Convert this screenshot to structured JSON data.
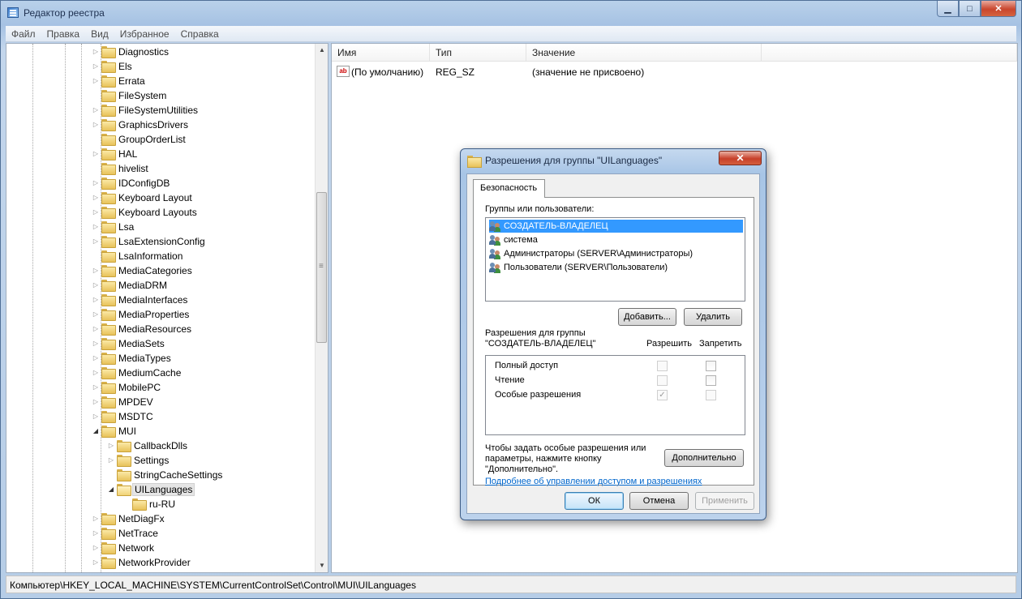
{
  "window": {
    "title": "Редактор реестра",
    "controls": {
      "minimize": "▁",
      "maximize": "□",
      "close": "✕"
    }
  },
  "menu": [
    "Файл",
    "Правка",
    "Вид",
    "Избранное",
    "Справка"
  ],
  "tree": {
    "items": [
      {
        "label": "Diagnostics",
        "expander": "▷",
        "level": 0
      },
      {
        "label": "Els",
        "expander": "▷",
        "level": 0
      },
      {
        "label": "Errata",
        "expander": "▷",
        "level": 0
      },
      {
        "label": "FileSystem",
        "expander": "",
        "level": 0
      },
      {
        "label": "FileSystemUtilities",
        "expander": "▷",
        "level": 0
      },
      {
        "label": "GraphicsDrivers",
        "expander": "▷",
        "level": 0
      },
      {
        "label": "GroupOrderList",
        "expander": "",
        "level": 0
      },
      {
        "label": "HAL",
        "expander": "▷",
        "level": 0
      },
      {
        "label": "hivelist",
        "expander": "",
        "level": 0
      },
      {
        "label": "IDConfigDB",
        "expander": "▷",
        "level": 0
      },
      {
        "label": "Keyboard Layout",
        "expander": "▷",
        "level": 0
      },
      {
        "label": "Keyboard Layouts",
        "expander": "▷",
        "level": 0
      },
      {
        "label": "Lsa",
        "expander": "▷",
        "level": 0
      },
      {
        "label": "LsaExtensionConfig",
        "expander": "▷",
        "level": 0
      },
      {
        "label": "LsaInformation",
        "expander": "",
        "level": 0
      },
      {
        "label": "MediaCategories",
        "expander": "▷",
        "level": 0
      },
      {
        "label": "MediaDRM",
        "expander": "▷",
        "level": 0
      },
      {
        "label": "MediaInterfaces",
        "expander": "▷",
        "level": 0
      },
      {
        "label": "MediaProperties",
        "expander": "▷",
        "level": 0
      },
      {
        "label": "MediaResources",
        "expander": "▷",
        "level": 0
      },
      {
        "label": "MediaSets",
        "expander": "▷",
        "level": 0
      },
      {
        "label": "MediaTypes",
        "expander": "▷",
        "level": 0
      },
      {
        "label": "MediumCache",
        "expander": "▷",
        "level": 0
      },
      {
        "label": "MobilePC",
        "expander": "▷",
        "level": 0
      },
      {
        "label": "MPDEV",
        "expander": "▷",
        "level": 0
      },
      {
        "label": "MSDTC",
        "expander": "▷",
        "level": 0
      },
      {
        "label": "MUI",
        "expander": "◢",
        "level": 0
      },
      {
        "label": "CallbackDlls",
        "expander": "▷",
        "level": 1
      },
      {
        "label": "Settings",
        "expander": "▷",
        "level": 1
      },
      {
        "label": "StringCacheSettings",
        "expander": "",
        "level": 1
      },
      {
        "label": "UILanguages",
        "expander": "◢",
        "level": 1,
        "selected": true
      },
      {
        "label": "ru-RU",
        "expander": "",
        "level": 2
      },
      {
        "label": "NetDiagFx",
        "expander": "▷",
        "level": 0
      },
      {
        "label": "NetTrace",
        "expander": "▷",
        "level": 0
      },
      {
        "label": "Network",
        "expander": "▷",
        "level": 0
      },
      {
        "label": "NetworkProvider",
        "expander": "▷",
        "level": 0
      }
    ],
    "scroll_up": "▲",
    "scroll_down": "▼"
  },
  "list": {
    "columns": [
      "Имя",
      "Тип",
      "Значение"
    ],
    "rows": [
      {
        "icon": "ab",
        "name": "(По умолчанию)",
        "type": "REG_SZ",
        "value": "(значение не присвоено)"
      }
    ]
  },
  "status_path": "Компьютер\\HKEY_LOCAL_MACHINE\\SYSTEM\\CurrentControlSet\\Control\\MUI\\UILanguages",
  "dialog": {
    "title": "Разрешения для группы \"UILanguages\"",
    "close": "✕",
    "tab": "Безопасность",
    "groups_label": "Группы или пользователи:",
    "users": [
      {
        "name": "СОЗДАТЕЛЬ-ВЛАДЕЛЕЦ",
        "selected": true
      },
      {
        "name": "система"
      },
      {
        "name": "Администраторы (SERVER\\Администраторы)"
      },
      {
        "name": "Пользователи (SERVER\\Пользователи)"
      }
    ],
    "add_button": "Добавить...",
    "remove_button": "Удалить",
    "perm_label_line1": "Разрешения для группы",
    "perm_label_line2": "\"СОЗДАТЕЛЬ-ВЛАДЕЛЕЦ\"",
    "allow_header": "Разрешить",
    "deny_header": "Запретить",
    "permissions": [
      {
        "name": "Полный доступ",
        "allow": false,
        "deny": false
      },
      {
        "name": "Чтение",
        "allow": false,
        "deny": false
      },
      {
        "name": "Особые разрешения",
        "allow": true,
        "deny": false
      }
    ],
    "advanced_text_line1": "Чтобы задать особые разрешения или",
    "advanced_text_line2": "параметры, нажмите кнопку",
    "advanced_text_line3": "\"Дополнительно\".",
    "advanced_button": "Дополнительно",
    "learn_more_link": "Подробнее об управлении доступом и разрешениях",
    "ok_button": "ОК",
    "cancel_button": "Отмена",
    "apply_button": "Применить"
  }
}
